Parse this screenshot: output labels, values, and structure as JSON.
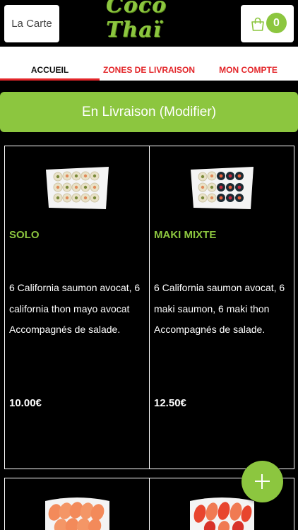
{
  "header": {
    "menu_label": "La Carte",
    "logo_text": "Coco Thaï",
    "cart_count": "0",
    "cart_icon": "shopping-bag-icon"
  },
  "tabs": [
    {
      "label": "ACCUEIL",
      "active": true
    },
    {
      "label": "ZONES DE LIVRAISON",
      "active": false
    },
    {
      "label": "MON COMPTE",
      "active": false
    }
  ],
  "delivery": {
    "label": "En Livraison (Modifier)"
  },
  "products": [
    {
      "title": "SOLO",
      "description": "6 California saumon avocat, 6 california thon mayo avocat Accompagnés de salade.",
      "price": "10.00€"
    },
    {
      "title": "MAKI MIXTE",
      "description": "6 California saumon avocat, 6 maki saumon, 6 maki thon Accompagnés de salade.",
      "price": "12.50€"
    }
  ],
  "colors": {
    "accent_green": "#8cc63f",
    "accent_red": "#e3262a",
    "background": "#000000"
  },
  "fab_icon": "plus-icon"
}
